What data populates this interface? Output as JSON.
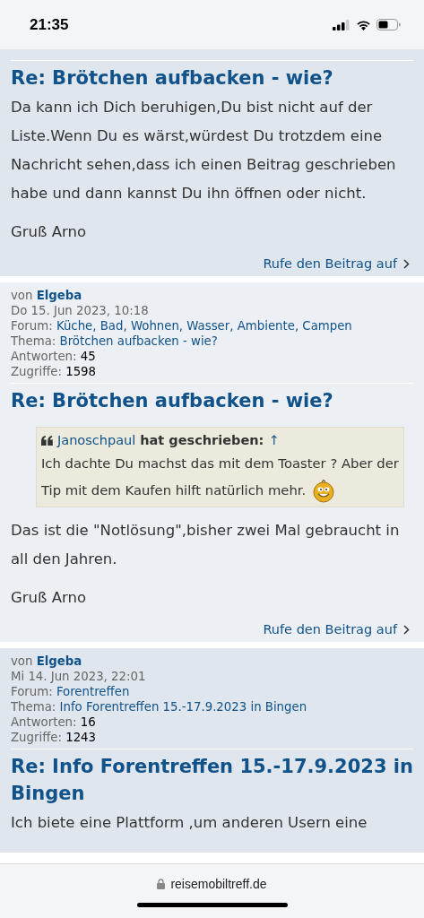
{
  "status_bar": {
    "time": "21:35"
  },
  "posts": [
    {
      "title": "Re: Brötchen aufbacken - wie?",
      "paragraphs": [
        "Da kann ich Dich beruhigen,Du bist nicht auf der Liste.Wenn Du es wärst,würdest Du trotzdem eine Nachricht sehen,dass ich einen Beitrag geschrieben habe und dann kannst Du ihn öffnen oder nicht.",
        "Gruß Arno"
      ],
      "read_more": "Rufe den Beitrag auf"
    },
    {
      "meta": {
        "by_label": "von",
        "author": "Elgeba",
        "date": "Do 15. Jun 2023, 10:18",
        "forum_label": "Forum:",
        "forum": "Küche, Bad, Wohnen, Wasser, Ambiente, Campen",
        "topic_label": "Thema:",
        "topic": "Brötchen aufbacken - wie?",
        "replies_label": "Antworten:",
        "replies": "45",
        "views_label": "Zugriffe:",
        "views": "1598"
      },
      "title": "Re: Brötchen aufbacken - wie?",
      "quote": {
        "author": "Janoschpaul",
        "wrote": "hat geschrieben:",
        "jump": "↑",
        "text": "Ich dachte Du machst das mit dem Toaster ? Aber der Tip mit dem Kaufen hilft natürlich mehr.",
        "smiley": true
      },
      "paragraphs": [
        "Das ist die \"Notlösung\",bisher zwei Mal gebraucht in all den Jahren.",
        "Gruß Arno"
      ],
      "read_more": "Rufe den Beitrag auf"
    },
    {
      "meta": {
        "by_label": "von",
        "author": "Elgeba",
        "date": "Mi 14. Jun 2023, 22:01",
        "forum_label": "Forum:",
        "forum": "Forentreffen",
        "topic_label": "Thema:",
        "topic": "Info Forentreffen 15.-17.9.2023 in Bingen",
        "replies_label": "Antworten:",
        "replies": "16",
        "views_label": "Zugriffe:",
        "views": "1243"
      },
      "title": "Re: Info Forentreffen 15.-17.9.2023 in Bingen",
      "paragraphs": [
        "Ich biete eine Plattform ,um anderen Usern eine"
      ]
    }
  ],
  "address_bar": {
    "url": "reisemobiltreff.de"
  }
}
